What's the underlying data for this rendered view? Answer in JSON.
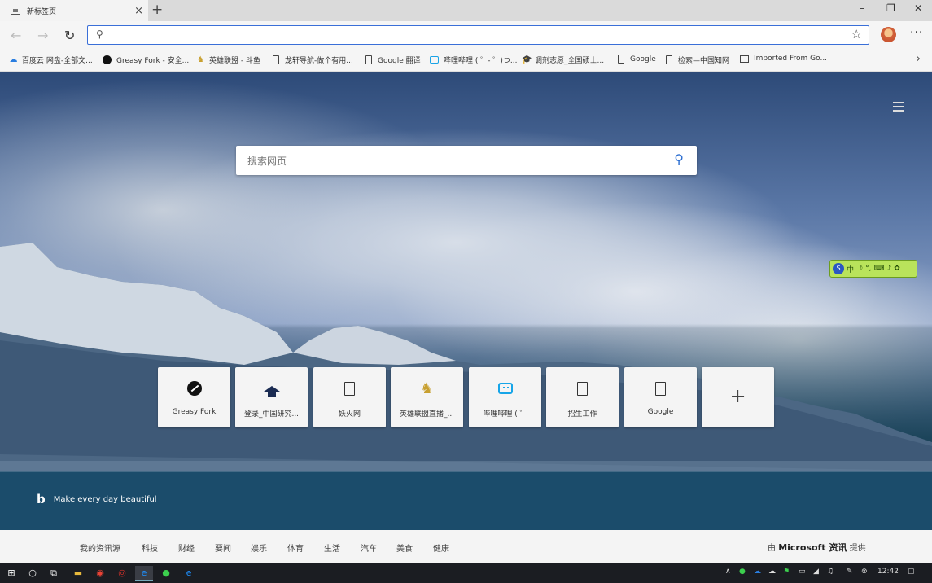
{
  "browser": {
    "tab_title": "新标签页",
    "tab_close": "×",
    "new_tab": "+",
    "window_controls": {
      "minimize": "–",
      "maximize": "❐",
      "close": "✕"
    },
    "address_placeholder": "",
    "address_value": ""
  },
  "bookmarks": [
    {
      "label": "百度云 网盘-全部文...",
      "icon": "cloud-icon"
    },
    {
      "label": "Greasy Fork - 安全...",
      "icon": "greasyfork-icon"
    },
    {
      "label": "英雄联盟 - 斗鱼",
      "icon": "fox-icon"
    },
    {
      "label": "龙轩导航-做个有用...",
      "icon": "document-icon"
    },
    {
      "label": "Google 翻译",
      "icon": "document-icon"
    },
    {
      "label": "哔哩哔哩 ( ゜- ゜)つ...",
      "icon": "bilibili-icon"
    },
    {
      "label": "调剂志愿_全国硕士...",
      "icon": "graduation-cap-icon"
    },
    {
      "label": "Google",
      "icon": "document-icon"
    },
    {
      "label": "检索—中国知网",
      "icon": "document-icon"
    },
    {
      "label": "Imported From Go...",
      "icon": "folder-icon"
    }
  ],
  "search": {
    "placeholder": "搜索网页"
  },
  "tiles": [
    {
      "label": "Greasy Fork",
      "icon": "greasyfork-icon"
    },
    {
      "label": "登录_中国研究...",
      "icon": "graduation-cap-icon"
    },
    {
      "label": "妖火网",
      "icon": "document-icon"
    },
    {
      "label": "英雄联盟直播_...",
      "icon": "fox-icon"
    },
    {
      "label": "哔哩哔哩 ( ゜",
      "icon": "bilibili-icon"
    },
    {
      "label": "招生工作",
      "icon": "document-icon"
    },
    {
      "label": "Google",
      "icon": "document-icon"
    },
    {
      "label": "+",
      "icon": "add-icon"
    }
  ],
  "bing_tagline": "Make every day beautiful",
  "ime_bar": {
    "lang": "中"
  },
  "news_nav": [
    "我的资讯源",
    "科技",
    "财经",
    "要闻",
    "娱乐",
    "体育",
    "生活",
    "汽车",
    "美食",
    "健康"
  ],
  "news_provider": {
    "prefix": "由",
    "brand": "Microsoft 资讯",
    "suffix": "提供"
  },
  "taskbar": {
    "time": "12:42"
  }
}
